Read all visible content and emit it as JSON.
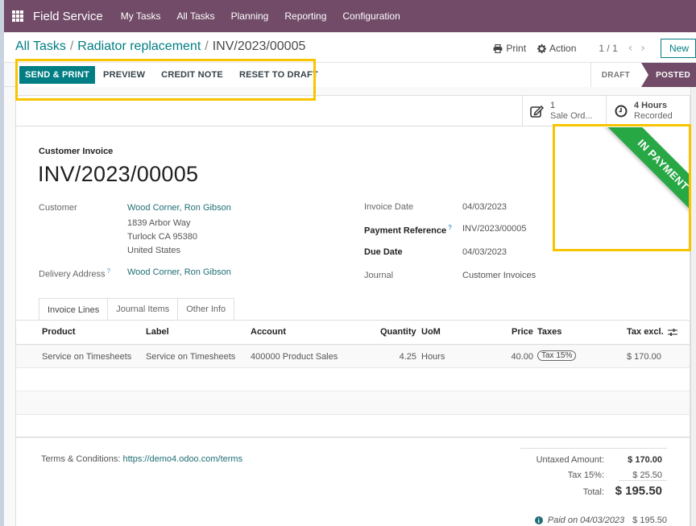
{
  "navbar": {
    "app_name": "Field Service",
    "menu": [
      "My Tasks",
      "All Tasks",
      "Planning",
      "Reporting",
      "Configuration"
    ]
  },
  "breadcrumb": {
    "items": [
      "All Tasks",
      "Radiator replacement"
    ],
    "current": "INV/2023/00005",
    "separator": "/"
  },
  "control_panel": {
    "print_label": "Print",
    "action_label": "Action",
    "pager": "1 / 1",
    "new_label": "New"
  },
  "actions": {
    "send_print": "SEND & PRINT",
    "preview": "PREVIEW",
    "credit_note": "CREDIT NOTE",
    "reset_to_draft": "RESET TO DRAFT"
  },
  "status": {
    "stages": [
      "DRAFT",
      "POSTED"
    ],
    "current": "POSTED",
    "ribbon": "IN PAYMENT",
    "ribbon_color": "#28a745",
    "brand_color": "#714b67",
    "primary_color": "#017e84"
  },
  "smart_buttons": {
    "sale_orders": {
      "value": "1",
      "label": "Sale Ord..."
    },
    "hours": {
      "value": "4 Hours",
      "label": "Recorded"
    }
  },
  "invoice": {
    "type": "Customer Invoice",
    "name": "INV/2023/00005",
    "customer_label": "Customer",
    "customer_name": "Wood Corner, Ron Gibson",
    "address_line1": "1839 Arbor Way",
    "address_line2": "Turlock CA 95380",
    "address_line3": "United States",
    "delivery_label": "Delivery Address",
    "delivery_value": "Wood Corner, Ron Gibson",
    "invoice_date_label": "Invoice Date",
    "invoice_date": "04/03/2023",
    "payment_ref_label": "Payment Reference",
    "payment_ref": "INV/2023/00005",
    "due_date_label": "Due Date",
    "due_date": "04/03/2023",
    "journal_label": "Journal",
    "journal": "Customer Invoices",
    "help_mark": "?"
  },
  "tabs": [
    "Invoice Lines",
    "Journal Items",
    "Other Info"
  ],
  "lines": {
    "headers": {
      "product": "Product",
      "label": "Label",
      "account": "Account",
      "quantity": "Quantity",
      "uom": "UoM",
      "price": "Price",
      "taxes": "Taxes",
      "tax_excl": "Tax excl."
    },
    "rows": [
      {
        "product": "Service on Timesheets",
        "label": "Service on Timesheets",
        "account": "400000 Product Sales",
        "quantity": "4.25",
        "uom": "Hours",
        "price": "40.00",
        "taxes": "Tax 15%",
        "tax_excl": "$ 170.00"
      }
    ]
  },
  "footer": {
    "terms_label": "Terms & Conditions:",
    "terms_link": "https://demo4.odoo.com/terms",
    "untaxed_label": "Untaxed Amount:",
    "untaxed_value": "$ 170.00",
    "tax_label": "Tax 15%:",
    "tax_value": "$ 25.50",
    "total_label": "Total:",
    "total_value": "$ 195.50",
    "paid_text": "Paid on 04/03/2023",
    "paid_value": "$ 195.50"
  }
}
